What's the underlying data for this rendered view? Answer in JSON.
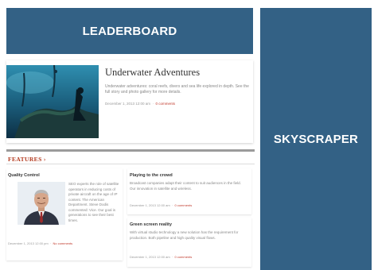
{
  "ads": {
    "leaderboard": "LEADERBOARD",
    "skyscraper": "SKYSCRAPER"
  },
  "hero": {
    "title": "Underwater Adventures",
    "excerpt": "Underwater adventures: coral reefs, divers and sea life explored in depth. See the full story and photo gallery for more details.",
    "meta_date": "December 1, 2013 12:00 am",
    "meta_link": "0 comments"
  },
  "features": {
    "title": "FEATURES ›",
    "cards": [
      {
        "title": "Quality Control",
        "text": "SEO experts the role of satellite operators in reducing costs of private aircraft on the age of IP content. The American Department. Steve Dodis commented: Vice. Our goal is generations to see their best times.",
        "meta_date": "December 1, 2013 12:00 pm",
        "meta_link": "No comments"
      },
      {
        "title": "Playing to the crowd",
        "text": "Broadcast companies adapt their content to suit audiences in the field. Our innovation in satellite and wireless.",
        "meta_date": "December 1, 2013 12:00 am",
        "meta_link": "0 comments"
      },
      {
        "title": "Green screen reality",
        "text": "With virtual studio technology a new solution has the requirement for production. Both pipeline and high quality visual flows.",
        "meta_date": "December 1, 2013 12:00 am",
        "meta_link": "0 comments"
      }
    ]
  }
}
